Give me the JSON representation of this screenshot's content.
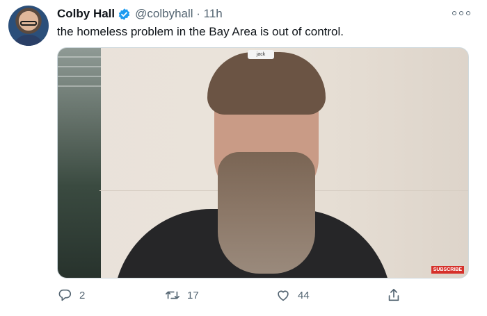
{
  "tweet": {
    "author_name": "Colby Hall",
    "handle_time": "@colbyhall · 11h",
    "text": "the homeless problem in the Bay Area is out of control.",
    "media": {
      "video_label": "jack",
      "subscribe_label": "SUBSCRIBE"
    },
    "actions": {
      "reply_count": "2",
      "retweet_count": "17",
      "like_count": "44"
    }
  },
  "icons": {
    "verified": "verified-badge-icon",
    "more": "more-icon",
    "reply": "reply-icon",
    "retweet": "retweet-icon",
    "like": "heart-icon",
    "share": "share-icon"
  },
  "colors": {
    "verified": "#1d9bf0",
    "text_primary": "#0f1419",
    "text_secondary": "#536471"
  }
}
